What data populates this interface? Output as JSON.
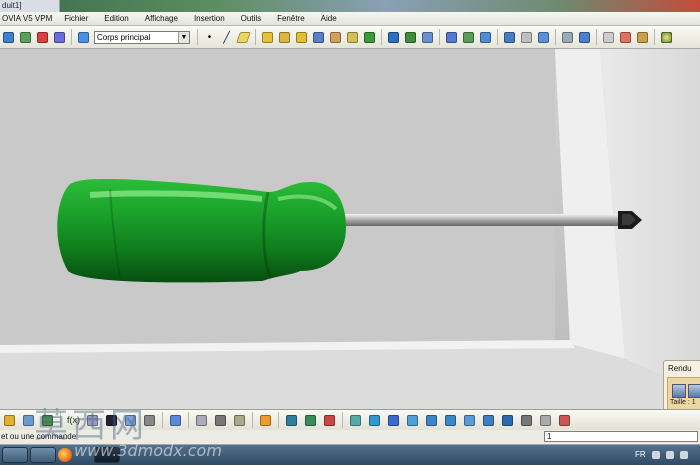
{
  "window": {
    "title_fragment": "duit1]",
    "app_label": "OVIA V5 VPM"
  },
  "menu": [
    {
      "label": "Fichier",
      "underline": "F"
    },
    {
      "label": "Edition",
      "underline": "E"
    },
    {
      "label": "Affichage",
      "underline": "A"
    },
    {
      "label": "Insertion",
      "underline": "I"
    },
    {
      "label": "Outils",
      "underline": "O"
    },
    {
      "label": "Fenêtre",
      "underline": "F"
    },
    {
      "label": "Aide",
      "underline": "A"
    }
  ],
  "toolbar": {
    "body_select": "Corps principal"
  },
  "rendu_panel": {
    "title": "Rendu",
    "label": "Taille : 1"
  },
  "statusbar": {
    "message": "et ou une commande",
    "command_value": "1"
  },
  "taskbar": {
    "language": "FR"
  },
  "watermark": {
    "chinese": "莫西网",
    "url": "www.3dmodx.com"
  },
  "colors": {
    "handle_green": "#1fa52e",
    "handle_dark": "#0a5a14",
    "shaft_gray": "#a8a8a8",
    "background_gray": "#c4c4c4"
  },
  "icons": {
    "toolbar_top": [
      "part-icon",
      "sketch-icon",
      "axis-icon",
      "body-icon",
      "body-select-icon",
      "point-icon",
      "line-icon",
      "plane-icon",
      "pad-icon",
      "pocket-icon",
      "shaft-icon",
      "groove-icon",
      "hole-icon",
      "rib-icon",
      "fillet-icon",
      "chamfer-icon",
      "draft-icon",
      "shell-icon",
      "thickness-icon",
      "pattern-icon",
      "mirror-icon",
      "scale-icon",
      "boolean-icon",
      "union-icon",
      "measure-icon",
      "analysis-icon",
      "knowledge-icon",
      "formula-icon",
      "law-icon",
      "rules-icon",
      "apply-material-icon"
    ],
    "toolbar_bottom": [
      "update-icon",
      "paste-icon",
      "undo-icon",
      "formula-icon",
      "catalog-icon",
      "table-icon",
      "hierarchy-icon",
      "keyboard-icon",
      "swap-icon",
      "3d-compass-icon",
      "zoom-icon",
      "render-icon",
      "pan-icon",
      "rotate-icon",
      "zoom-in-icon",
      "zoom-out-icon",
      "normal-view-icon",
      "iso-view-icon",
      "shading-icon",
      "hide-show-icon"
    ]
  }
}
